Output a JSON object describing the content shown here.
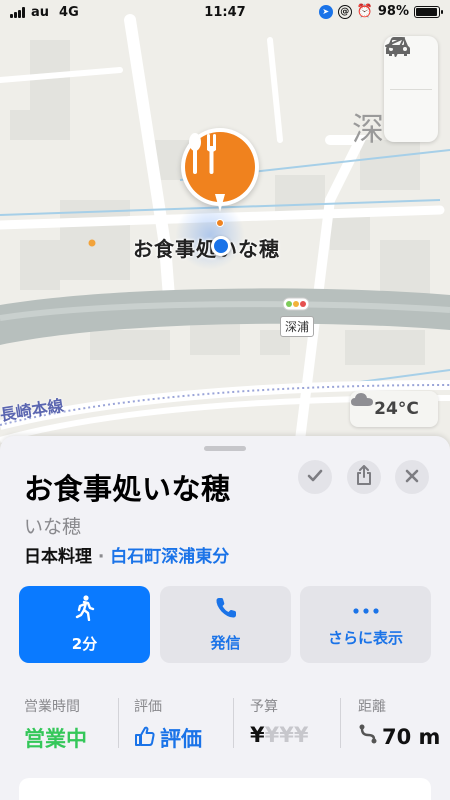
{
  "status_bar": {
    "carrier": "au",
    "network": "4G",
    "time": "11:47",
    "battery": "98%"
  },
  "map": {
    "place_label": "お食事処いな穂",
    "district_label": "深",
    "station_label": "深浦",
    "rail_label": "長崎本線",
    "weather": {
      "temp": "24°C",
      "icon": "cloud-icon"
    },
    "poi_icon": "fork-knife-icon",
    "colors": {
      "pin": "#f0821e",
      "user_location": "#1a73e8"
    }
  },
  "place": {
    "title": "お食事処いな穂",
    "subtitle": "いな穂",
    "category": "日本料理",
    "separator": " · ",
    "area_link": "白石町深浦東分"
  },
  "actions": [
    {
      "label": "2分",
      "icon": "walk-icon"
    },
    {
      "label": "発信",
      "icon": "phone-icon"
    },
    {
      "label": "さらに表示",
      "icon": "more-icon"
    }
  ],
  "info": {
    "hours": {
      "heading": "営業時間",
      "value": "営業中"
    },
    "rating": {
      "heading": "評価",
      "value": "評価"
    },
    "budget": {
      "heading": "予算",
      "value_active": "¥",
      "value_inactive": "¥¥¥"
    },
    "distance": {
      "heading": "距離",
      "value": "70 m"
    }
  },
  "accent_colors": {
    "blue": "#0a7aff",
    "open_green": "#34c759"
  }
}
